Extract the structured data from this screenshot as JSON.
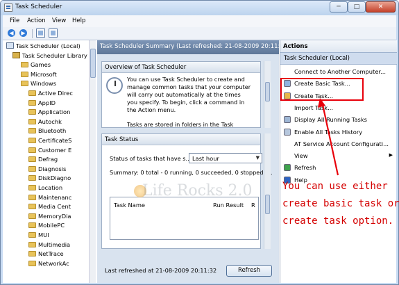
{
  "window": {
    "title": "Task Scheduler",
    "minimize": "─",
    "maximize": "□",
    "close": "✕"
  },
  "menu": [
    "File",
    "Action",
    "View",
    "Help"
  ],
  "tree": [
    {
      "label": "Task Scheduler (Local)",
      "icon": "computer-icon",
      "level": 0,
      "twisty": ""
    },
    {
      "label": "Task Scheduler Library",
      "icon": "library-icon",
      "level": 1,
      "twisty": "◢"
    },
    {
      "label": "Games",
      "icon": "folder-icon",
      "level": 2,
      "twisty": ""
    },
    {
      "label": "Microsoft",
      "icon": "folder-icon",
      "level": 2,
      "twisty": "◢"
    },
    {
      "label": "Windows",
      "icon": "folder-icon",
      "level": 3,
      "twisty": "◢"
    },
    {
      "label": "Active Direc",
      "icon": "folder-icon",
      "level": 4,
      "twisty": ""
    },
    {
      "label": "AppID",
      "icon": "folder-icon",
      "level": 4,
      "twisty": ""
    },
    {
      "label": "Application",
      "icon": "folder-icon",
      "level": 4,
      "twisty": ""
    },
    {
      "label": "Autochk",
      "icon": "folder-icon",
      "level": 4,
      "twisty": ""
    },
    {
      "label": "Bluetooth",
      "icon": "folder-icon",
      "level": 4,
      "twisty": ""
    },
    {
      "label": "CertificateS",
      "icon": "folder-icon",
      "level": 4,
      "twisty": ""
    },
    {
      "label": "Customer E",
      "icon": "folder-icon",
      "level": 4,
      "twisty": ""
    },
    {
      "label": "Defrag",
      "icon": "folder-icon",
      "level": 4,
      "twisty": ""
    },
    {
      "label": "Diagnosis",
      "icon": "folder-icon",
      "level": 4,
      "twisty": ""
    },
    {
      "label": "DiskDiagno",
      "icon": "folder-icon",
      "level": 4,
      "twisty": ""
    },
    {
      "label": "Location",
      "icon": "folder-icon",
      "level": 4,
      "twisty": ""
    },
    {
      "label": "Maintenanc",
      "icon": "folder-icon",
      "level": 4,
      "twisty": ""
    },
    {
      "label": "Media Cent",
      "icon": "folder-icon",
      "level": 4,
      "twisty": "▷"
    },
    {
      "label": "MemoryDia",
      "icon": "folder-icon",
      "level": 4,
      "twisty": ""
    },
    {
      "label": "MobilePC",
      "icon": "folder-icon",
      "level": 4,
      "twisty": ""
    },
    {
      "label": "MUI",
      "icon": "folder-icon",
      "level": 4,
      "twisty": ""
    },
    {
      "label": "Multimedia",
      "icon": "folder-icon",
      "level": 4,
      "twisty": ""
    },
    {
      "label": "NetTrace",
      "icon": "folder-icon",
      "level": 4,
      "twisty": ""
    },
    {
      "label": "NetworkAc",
      "icon": "folder-icon",
      "level": 4,
      "twisty": ""
    }
  ],
  "summary": {
    "header": "Task Scheduler Summary (Last refreshed: 21-08-2009 20:11:32)",
    "overview": {
      "title": "Overview of Task Scheduler",
      "text": "You can use Task Scheduler to create and manage common tasks that your computer will carry out automatically at the times you specify. To begin, click a command in the Action menu.",
      "text2": "Tasks are stored in folders in the Task"
    },
    "status": {
      "title": "Task Status",
      "label": "Status of tasks that have s...",
      "select": "Last hour",
      "summary": "Summary: 0 total - 0 running, 0 succeeded, 0 stopped, ...",
      "col_name": "Task Name",
      "col_result": "Run Result",
      "col_extra": "R"
    },
    "footer": "Last refreshed at 21-08-2009 20:11:32",
    "refresh_button": "Refresh"
  },
  "actions": {
    "header": "Actions",
    "group": "Task Scheduler (Local)",
    "items": [
      {
        "label": "Connect to Another Computer...",
        "icon": "",
        "color": ""
      },
      {
        "label": "Create Basic Task...",
        "icon": "wizard-icon",
        "color": "#8fb3e0"
      },
      {
        "label": "Create Task...",
        "icon": "task-icon",
        "color": "#e7b84a"
      },
      {
        "label": "Import Task...",
        "icon": "",
        "color": ""
      },
      {
        "label": "Display All Running Tasks",
        "icon": "list-icon",
        "color": "#9fb7d5"
      },
      {
        "label": "Enable All Tasks History",
        "icon": "history-icon",
        "color": "#b6c7dd"
      },
      {
        "label": "AT Service Account Configurati...",
        "icon": "",
        "color": ""
      },
      {
        "label": "View",
        "icon": "",
        "color": ""
      },
      {
        "label": "Refresh",
        "icon": "refresh-icon",
        "color": "#3fa34d"
      },
      {
        "label": "Help",
        "icon": "help-icon",
        "color": "#2c63c4"
      }
    ]
  },
  "annotation": {
    "lines": [
      "You can use either",
      "create basic task or",
      "create task option."
    ],
    "color": "#e8000a"
  },
  "watermark": "Life Rocks 2.0"
}
